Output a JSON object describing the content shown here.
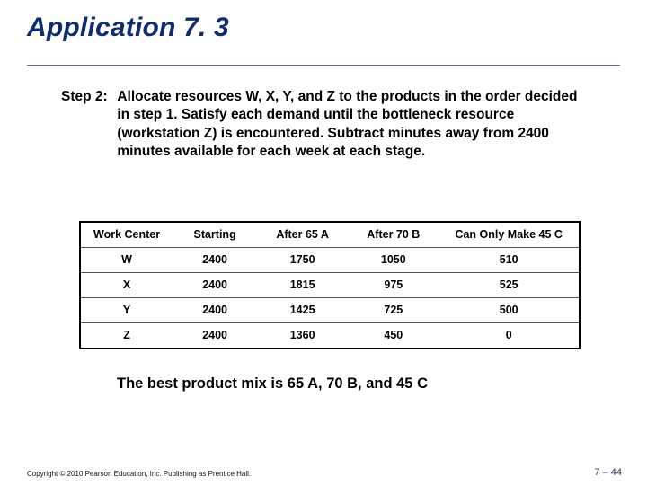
{
  "title": "Application 7. 3",
  "step": {
    "label": "Step 2:",
    "text": "Allocate resources W, X, Y, and Z to the products in the order decided in step 1. Satisfy each demand until the bottleneck resource (workstation Z) is encountered. Subtract minutes away from 2400 minutes available for each week at each stage."
  },
  "chart_data": {
    "type": "table",
    "columns": [
      "Work Center",
      "Starting",
      "After 65 A",
      "After 70 B",
      "Can Only Make 45 C"
    ],
    "rows": [
      {
        "center": "W",
        "starting": "2400",
        "after_a": "1750",
        "after_b": "1050",
        "after_c": "510"
      },
      {
        "center": "X",
        "starting": "2400",
        "after_a": "1815",
        "after_b": "975",
        "after_c": "525"
      },
      {
        "center": "Y",
        "starting": "2400",
        "after_a": "1425",
        "after_b": "725",
        "after_c": "500"
      },
      {
        "center": "Z",
        "starting": "2400",
        "after_a": "1360",
        "after_b": "450",
        "after_c": "0"
      }
    ]
  },
  "conclusion": "The best product mix is 65 A, 70 B, and 45 C",
  "footer": {
    "copyright": "Copyright © 2010 Pearson Education, Inc. Publishing as Prentice Hall.",
    "page": "7 – 44"
  }
}
